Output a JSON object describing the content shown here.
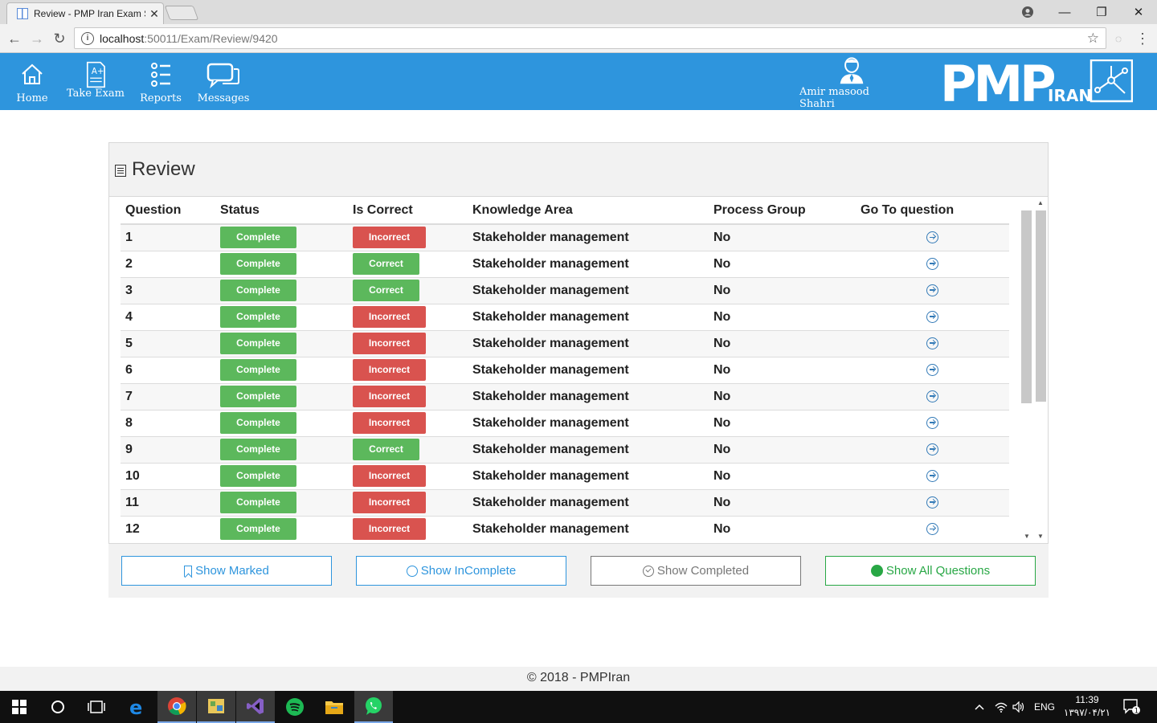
{
  "browser": {
    "tab_title": "Review - PMP Iran Exam S",
    "url_host": "localhost",
    "url_path": ":50011/Exam/Review/9420"
  },
  "nav": {
    "home": "Home",
    "take_exam": "Take Exam",
    "reports": "Reports",
    "messages": "Messages",
    "user_name": "Amir masood Shahri"
  },
  "logo": {
    "main": "PMP",
    "sub": "IRAN"
  },
  "review": {
    "title": "Review",
    "columns": [
      "Question",
      "Status",
      "Is Correct",
      "Knowledge Area",
      "Process Group",
      "Go To question"
    ],
    "rows": [
      {
        "q": "1",
        "status": "Complete",
        "correct": "Incorrect",
        "area": "Stakeholder management",
        "group": "No"
      },
      {
        "q": "2",
        "status": "Complete",
        "correct": "Correct",
        "area": "Stakeholder management",
        "group": "No"
      },
      {
        "q": "3",
        "status": "Complete",
        "correct": "Correct",
        "area": "Stakeholder management",
        "group": "No"
      },
      {
        "q": "4",
        "status": "Complete",
        "correct": "Incorrect",
        "area": "Stakeholder management",
        "group": "No"
      },
      {
        "q": "5",
        "status": "Complete",
        "correct": "Incorrect",
        "area": "Stakeholder management",
        "group": "No"
      },
      {
        "q": "6",
        "status": "Complete",
        "correct": "Incorrect",
        "area": "Stakeholder management",
        "group": "No"
      },
      {
        "q": "7",
        "status": "Complete",
        "correct": "Incorrect",
        "area": "Stakeholder management",
        "group": "No"
      },
      {
        "q": "8",
        "status": "Complete",
        "correct": "Incorrect",
        "area": "Stakeholder management",
        "group": "No"
      },
      {
        "q": "9",
        "status": "Complete",
        "correct": "Correct",
        "area": "Stakeholder management",
        "group": "No"
      },
      {
        "q": "10",
        "status": "Complete",
        "correct": "Incorrect",
        "area": "Stakeholder management",
        "group": "No"
      },
      {
        "q": "11",
        "status": "Complete",
        "correct": "Incorrect",
        "area": "Stakeholder management",
        "group": "No"
      },
      {
        "q": "12",
        "status": "Complete",
        "correct": "Incorrect",
        "area": "Stakeholder management",
        "group": "No"
      }
    ]
  },
  "filters": {
    "marked": "Show Marked",
    "incomplete": "Show InComplete",
    "completed": "Show Completed",
    "all": "Show All Questions"
  },
  "footer": {
    "text": "© 2018 - PMPIran"
  },
  "taskbar": {
    "lang": "ENG",
    "time": "11:39",
    "date": "۱۳۹۷/۰۴/۲۱",
    "notification_count": "1"
  },
  "colors": {
    "header_blue": "#2e95dd",
    "success_green": "#5cb85c",
    "danger_red": "#d9534f"
  }
}
